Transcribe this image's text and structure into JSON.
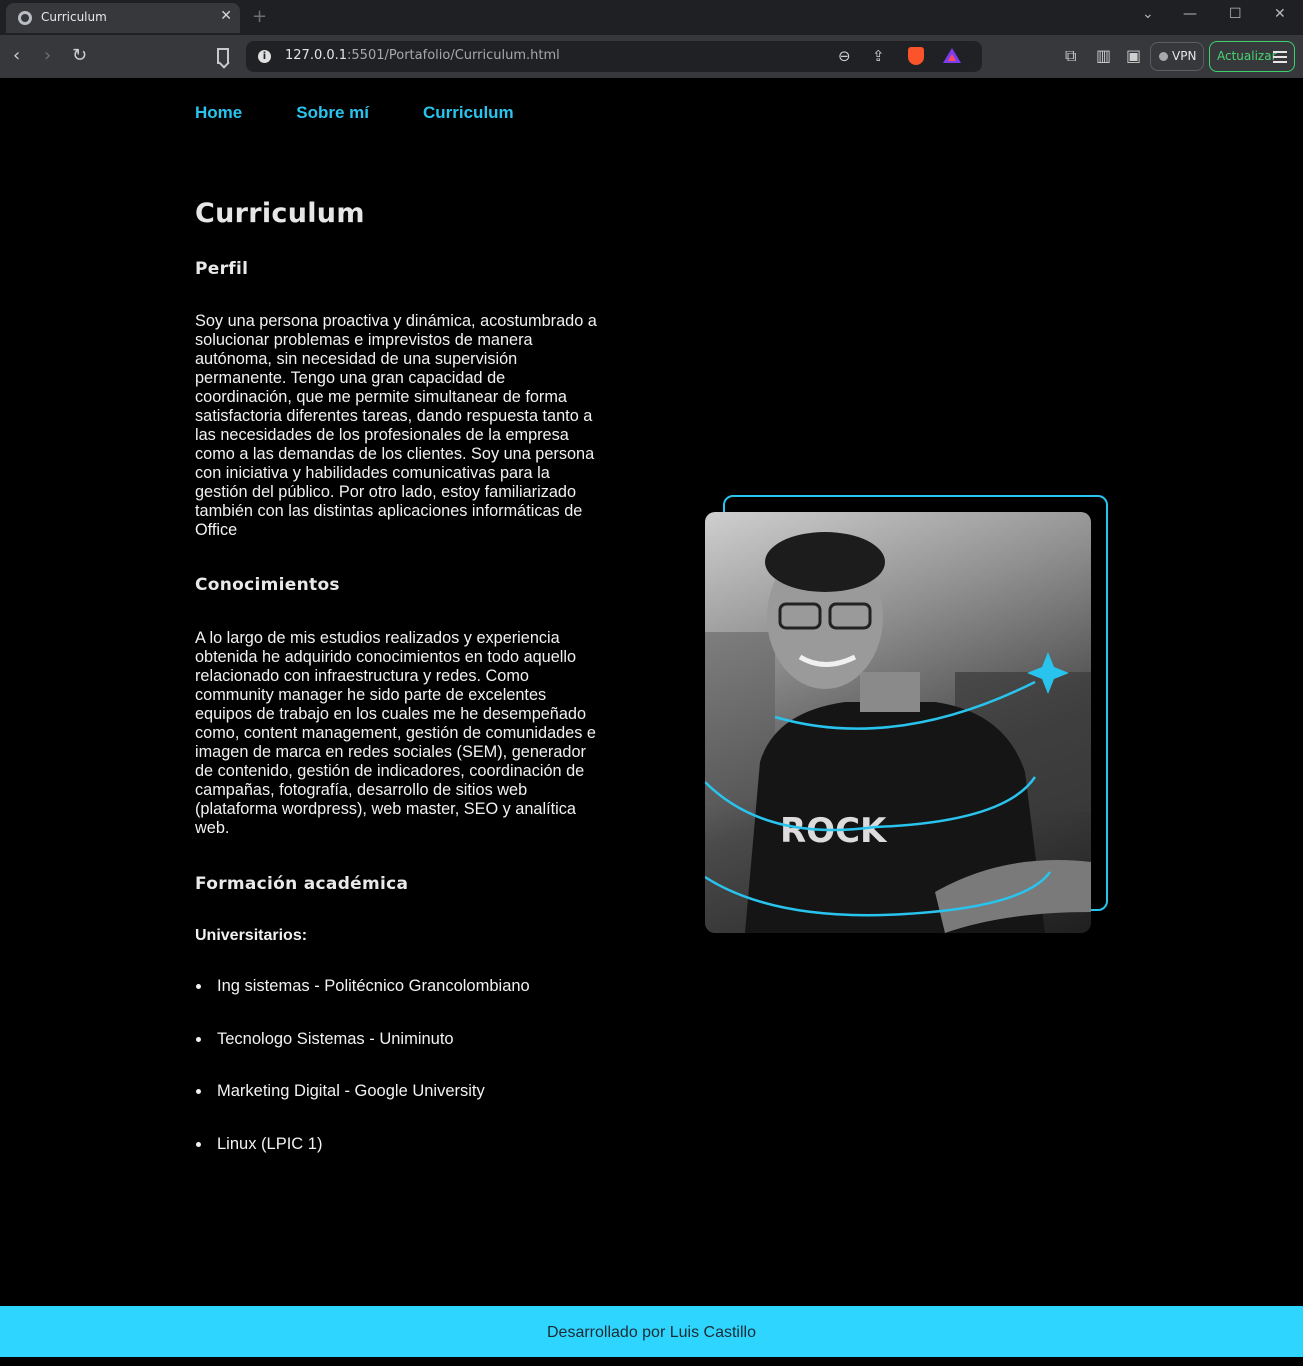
{
  "browser": {
    "tab_title": "Curriculum",
    "tab_close": "✕",
    "new_tab": "+",
    "url_host": "127.0.0.1",
    "url_rest": ":5501/Portafolio/Curriculum.html",
    "vpn_label": "VPN",
    "update_label": "Actualizar"
  },
  "nav": {
    "home": "Home",
    "about": "Sobre mí",
    "curriculum": "Curriculum"
  },
  "page_title": "Curriculum",
  "perfil": {
    "title": "Perfil",
    "text": "Soy una persona proactiva y dinámica, acostumbrado a solucionar problemas e imprevistos de manera autónoma, sin necesidad de una supervisión permanente. Tengo una gran capacidad de coordinación, que me permite simultanear de forma satisfactoria diferentes tareas, dando respuesta tanto a las necesidades de los profesionales de la empresa como a las demandas de los clientes. Soy una persona con iniciativa y habilidades comunicativas para la gestión del público. Por otro lado, estoy familiarizado también con las distintas aplicaciones informáticas de Office"
  },
  "conocimientos": {
    "title": "Conocimientos",
    "text": "A lo largo de mis estudios realizados y experiencia obtenida he adquirido conocimientos en todo aquello relacionado con infraestructura y redes. Como community manager he sido parte de excelentes equipos de trabajo en los cuales me he desempeñado como, content management, gestión de comunidades e imagen de marca en redes sociales (SEM), generador de contenido, gestión de indicadores, coordinación de campañas, fotografía, desarrollo de sitios web (plataforma wordpress), web master, SEO y analítica web."
  },
  "formacion": {
    "title": "Formación académica",
    "subtitle": "Universitarios:",
    "items": [
      "Ing sistemas - Politécnico Grancolombiano",
      "Tecnologo Sistemas - Uniminuto",
      "Marketing Digital - Google University",
      "Linux (LPIC 1)"
    ]
  },
  "footer": "Desarrollado por Luis Castillo",
  "colors": {
    "accent": "#29c4ee",
    "footer_bg": "#2ed6ff",
    "background": "#000000"
  }
}
